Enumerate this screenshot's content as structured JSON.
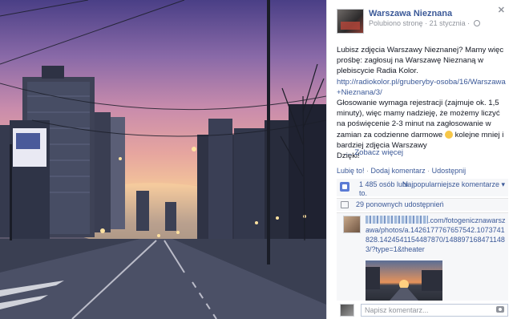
{
  "page": {
    "name": "Warszawa Nieznana",
    "liked": "Polubiono stronę",
    "date": "21 stycznia"
  },
  "post": {
    "line1": "Lubisz zdjęcia Warszawy Nieznanej? Mamy więc prośbę: zagłosuj na Warszawę Nieznaną w plebiscycie Radia Kolor.",
    "link": "http://radiokolor.pl/gruberyby-osoba/16/Warszawa+Nieznana/3/",
    "line2": "Głosowanie wymaga rejestracji (zajmuje ok. 1,5 minuty), więc mamy nadzieję, że możemy liczyć na poświęcenie 2-3 minut na zagłosowanie w zamian za codzienne darmowe",
    "line3": "kolejne mniej i bardziej zdjęcia Warszawy",
    "line4": "Dzięki!",
    "see_more": "Zobacz więcej"
  },
  "actions": {
    "like": "Lubię to!",
    "comment": "Dodaj komentarz",
    "share": "Udostępnij"
  },
  "likes": {
    "count_text": "1 485 osób lubi to.",
    "sort_label": "Najpopularniejsze komentarze"
  },
  "shares": {
    "text": "29 ponownych udostępnień"
  },
  "comment": {
    "link_text": ".com/fotogenicznawarszawa/photos/a.1426177767657542.1073741828.1424541154487870/1488971684711483/?type=1&theater"
  },
  "reply": {
    "placeholder": "Napisz komentarz..."
  },
  "colors": {
    "link": "#3b5998",
    "muted": "#90949c"
  }
}
